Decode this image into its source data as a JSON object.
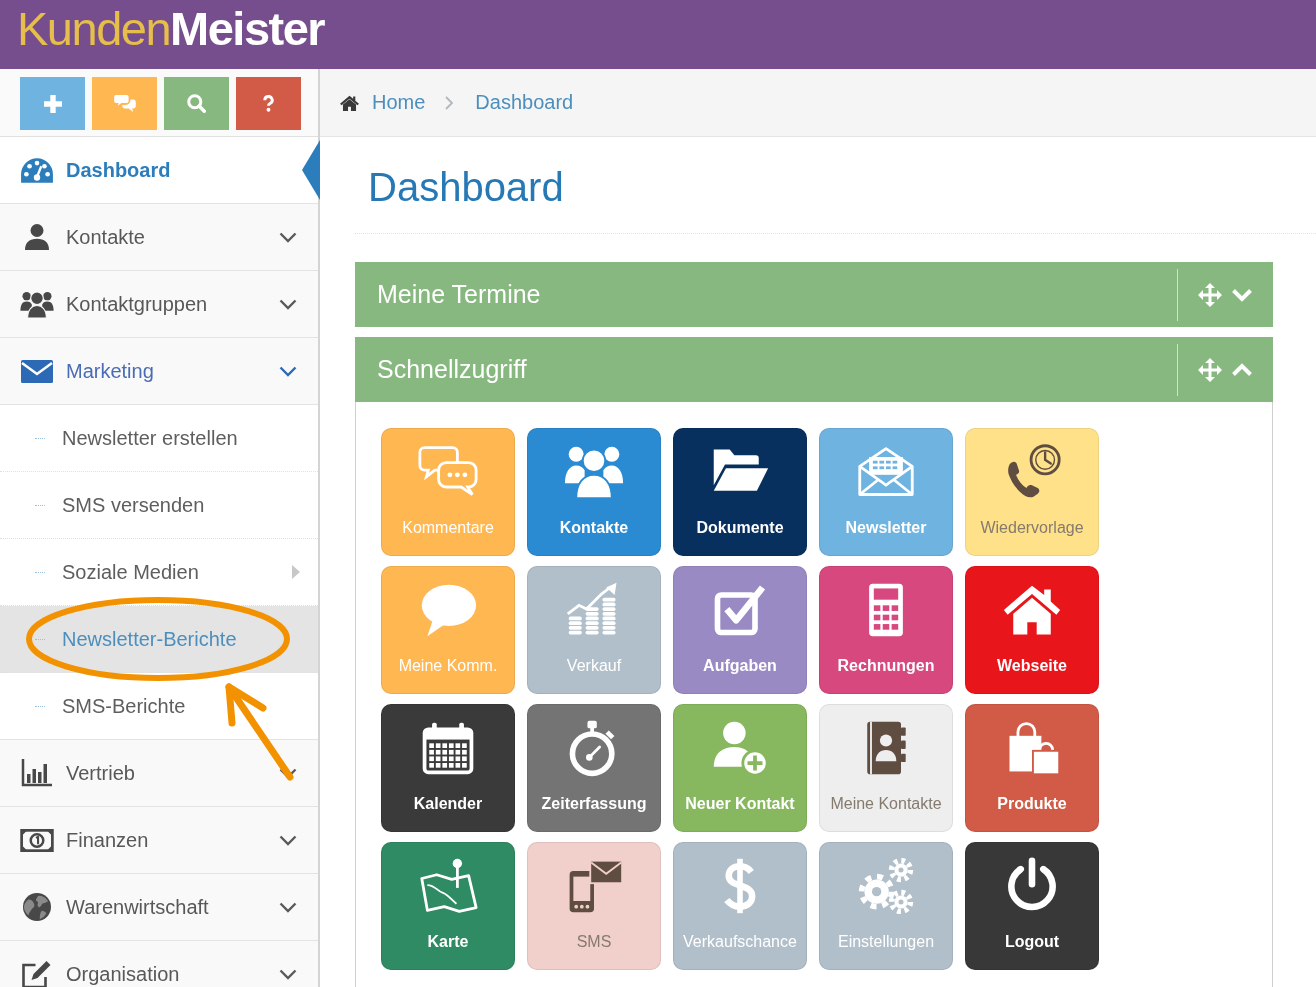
{
  "header": {
    "logo": "Kunden**Meister**"
  },
  "shortcuts": [
    {
      "color": "#6fb3e0"
    },
    {
      "color": "#ffb752"
    },
    {
      "color": "#87b87f"
    },
    {
      "color": "#d15b47"
    }
  ],
  "sidebar": {
    "items": [
      {
        "label": "Dashboard",
        "kind": "link",
        "selected": true,
        "expanded": false
      },
      {
        "label": "Kontakte",
        "kind": "menu",
        "selected": false,
        "expanded": false
      },
      {
        "label": "Kontaktgruppen",
        "kind": "menu",
        "selected": false,
        "expanded": false
      },
      {
        "label": "Marketing",
        "kind": "menu",
        "selected": false,
        "expanded": true,
        "children": [
          {
            "label": "Newsletter erstellen",
            "kind": "link",
            "selected": false
          },
          {
            "label": "SMS versenden",
            "kind": "link",
            "selected": false
          },
          {
            "label": "Soziale Medien",
            "kind": "submenu",
            "selected": false
          },
          {
            "label": "Newsletter-Berichte",
            "kind": "link",
            "selected": true
          },
          {
            "label": "SMS-Berichte",
            "kind": "link",
            "selected": false
          }
        ]
      },
      {
        "label": "Vertrieb",
        "kind": "menu",
        "selected": false,
        "expanded": false
      },
      {
        "label": "Finanzen",
        "kind": "menu",
        "selected": false,
        "expanded": false
      },
      {
        "label": "Warenwirtschaft",
        "kind": "menu",
        "selected": false,
        "expanded": false
      },
      {
        "label": "Organisation",
        "kind": "menu",
        "selected": false,
        "expanded": false
      }
    ]
  },
  "breadcrumbs": [
    {
      "label": "Home"
    },
    {
      "label": "Dashboard"
    }
  ],
  "page_title": "Dashboard",
  "widgets": [
    {
      "title": "Meine Termine",
      "expanded": false
    },
    {
      "title": "Schnellzugriff",
      "expanded": true,
      "tiles": [
        {
          "label": "Kommentare",
          "color": "#ffb752"
        },
        {
          "label": "Kontakte",
          "color": "#2b8bd2"
        },
        {
          "label": "Dokumente",
          "color": "#08305e"
        },
        {
          "label": "Newsletter",
          "color": "#6fb3e0"
        },
        {
          "label": "Wiedervorlage",
          "color": "#fee188"
        },
        {
          "label": "Meine Komm.",
          "color": "#ffb752"
        },
        {
          "label": "Verkauf",
          "color": "#b1bfca"
        },
        {
          "label": "Aufgaben",
          "color": "#9a8ac4"
        },
        {
          "label": "Rechnungen",
          "color": "#d6487e"
        },
        {
          "label": "Webseite",
          "color": "#e8161b"
        },
        {
          "label": "Kalender",
          "color": "#3a3a3a"
        },
        {
          "label": "Zeiterfassung",
          "color": "#747474"
        },
        {
          "label": "Neuer Kontakt",
          "color": "#87b85f"
        },
        {
          "label": "Meine Kontakte",
          "color": "#eeeeee"
        },
        {
          "label": "Produkte",
          "color": "#d15b47"
        },
        {
          "label": "Karte",
          "color": "#2e8b63"
        },
        {
          "label": "SMS",
          "color": "#f1cfca"
        },
        {
          "label": "Verkaufschance",
          "color": "#b1bfca"
        },
        {
          "label": "Einstellungen",
          "color": "#b1bfca"
        },
        {
          "label": "Logout",
          "color": "#383838"
        }
      ]
    }
  ]
}
